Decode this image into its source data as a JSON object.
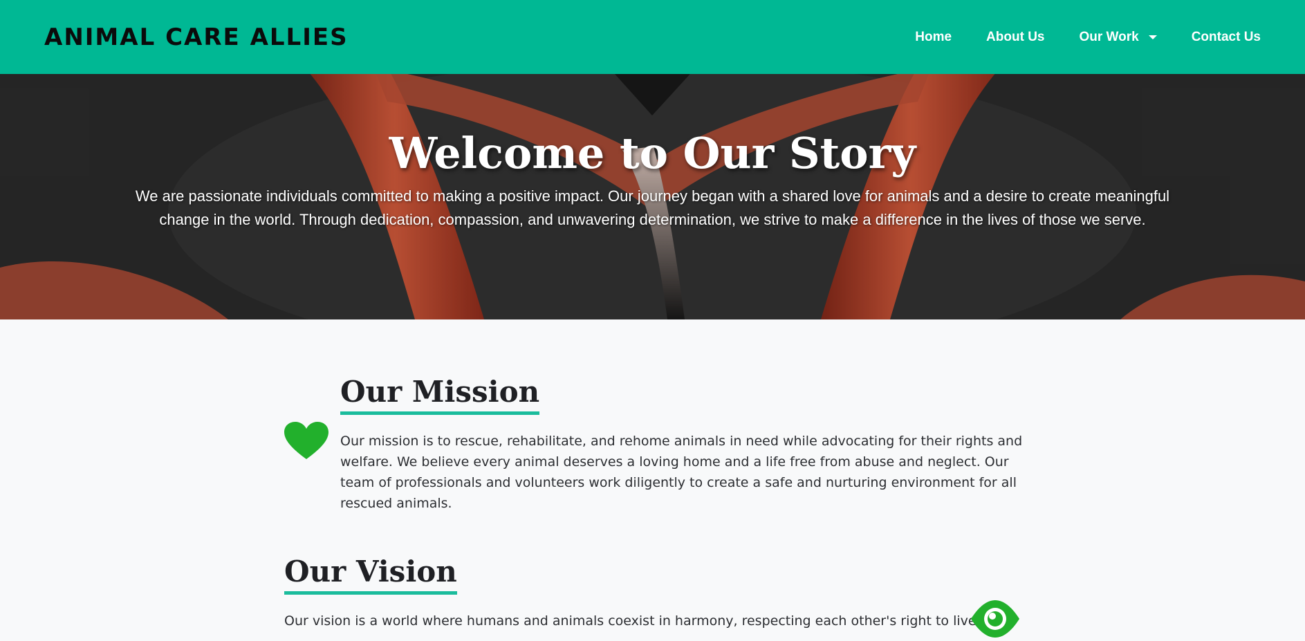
{
  "brand": "ANIMAL CARE ALLIES",
  "nav": {
    "items": [
      {
        "label": "Home"
      },
      {
        "label": "About Us"
      },
      {
        "label": "Our Work"
      },
      {
        "label": "Contact Us"
      }
    ]
  },
  "hero": {
    "title": "Welcome to Our Story",
    "text": "We are passionate individuals committed to making a positive impact. Our journey began with a shared love for animals and a desire to create meaningful change in the world. Through dedication, compassion, and unwavering determination, we strive to make a difference in the lives of those we serve."
  },
  "mission": {
    "title": "Our Mission",
    "icon": "heart-icon",
    "text": "Our mission is to rescue, rehabilitate, and rehome animals in need while advocating for their rights and welfare. We believe every animal deserves a loving home and a life free from abuse and neglect. Our team of professionals and volunteers work diligently to create a safe and nurturing environment for all rescued animals."
  },
  "vision": {
    "title": "Our Vision",
    "icon": "eye-icon",
    "text": "Our vision is a world where humans and animals coexist in harmony, respecting each other's right to live and"
  },
  "colors": {
    "navbar": "#00b894",
    "accent": "#1abc9c",
    "icon_green": "#22b02c"
  }
}
